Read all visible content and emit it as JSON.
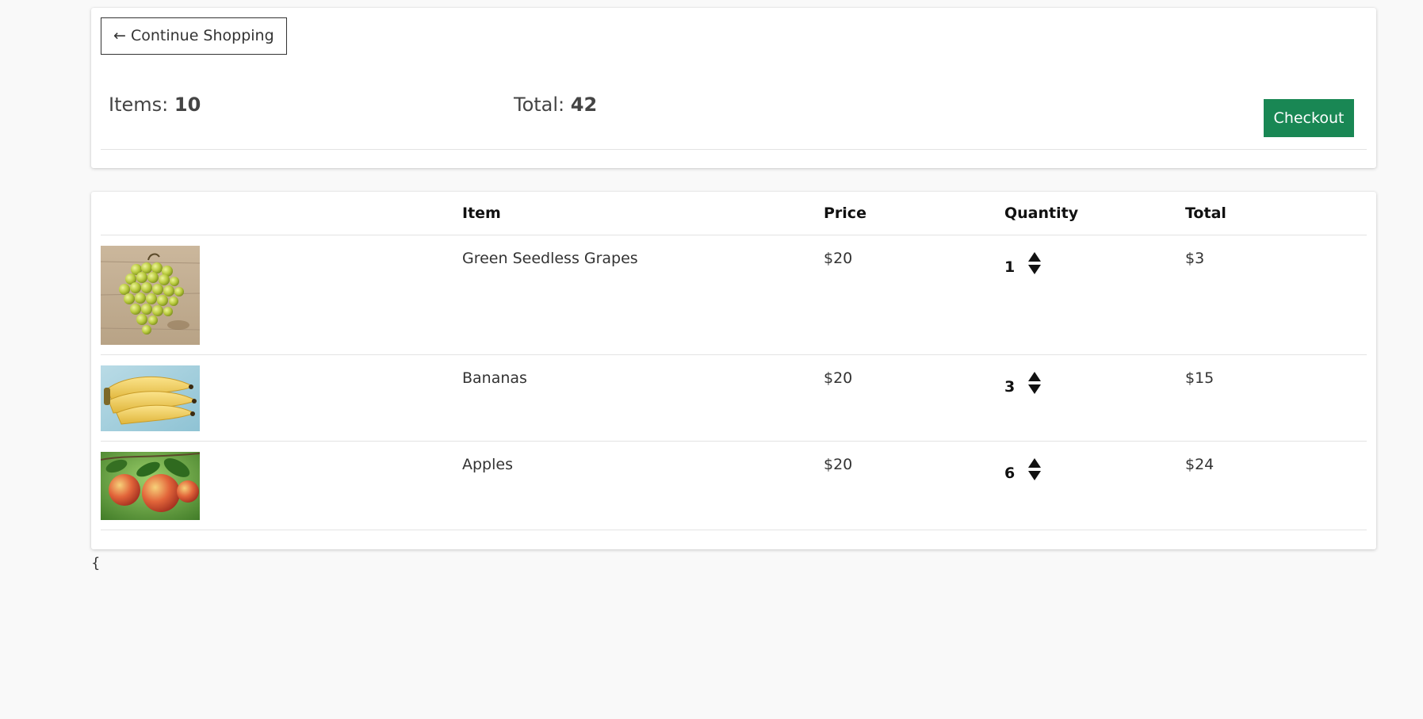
{
  "summary": {
    "continue_label": "← Continue Shopping",
    "items_label": "Items:",
    "items_value": "10",
    "total_label": "Total:",
    "total_value": "42",
    "checkout_label": "Checkout"
  },
  "table": {
    "headers": {
      "image": "",
      "item": "Item",
      "price": "Price",
      "quantity": "Quantity",
      "total": "Total"
    },
    "rows": [
      {
        "name": "Green Seedless Grapes",
        "price": "$20",
        "quantity": "1",
        "total": "$3",
        "image_icon": "grapes-image"
      },
      {
        "name": "Bananas",
        "price": "$20",
        "quantity": "3",
        "total": "$15",
        "image_icon": "bananas-image"
      },
      {
        "name": "Apples",
        "price": "$20",
        "quantity": "6",
        "total": "$24",
        "image_icon": "apples-image"
      }
    ]
  },
  "footer_text": "{",
  "colors": {
    "checkout_button": "#198754",
    "page_background": "#f9f9f9"
  }
}
